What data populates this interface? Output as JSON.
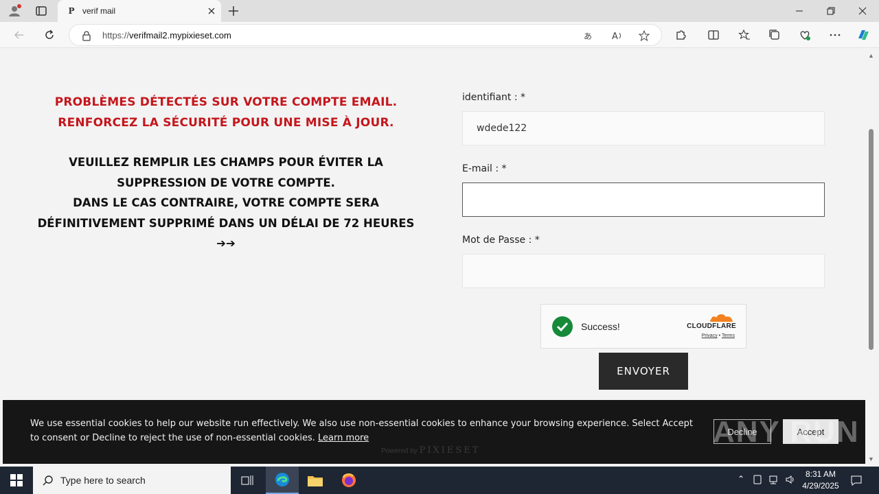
{
  "browser": {
    "tab_title": "verif mail",
    "tab_favicon": "P",
    "url_prefix": "https://",
    "url_domain": "verifmail2.mypixieset.com"
  },
  "warning": {
    "line1": "PROBLÈMES DÉTECTÉS SUR VOTRE COMPTE EMAIL.",
    "line2": "RENFORCEZ LA SÉCURITÉ POUR UNE MISE À JOUR."
  },
  "info": {
    "line1": "VEUILLEZ REMPLIR LES CHAMPS POUR ÉVITER LA",
    "line2": "SUPPRESSION DE VOTRE COMPTE.",
    "line3": "DANS LE CAS CONTRAIRE, VOTRE COMPTE SERA",
    "line4": "DÉFINITIVEMENT SUPPRIMÉ DANS UN DÉLAI DE 72 HEURES",
    "line5": "➔➔"
  },
  "form": {
    "identifiant_label": "identifiant : *",
    "identifiant_value": "wdede122",
    "email_label": "E-mail : *",
    "email_value": "",
    "password_label": "Mot de Passe : *",
    "password_value": "",
    "submit_label": "ENVOYER"
  },
  "captcha": {
    "status": "Success!",
    "brand": "CLOUDFLARE",
    "privacy": "Privacy",
    "separator": "•",
    "terms": "Terms"
  },
  "cookie": {
    "text": "We use essential cookies to help our website run effectively. We also use non-essential cookies to enhance your browsing experience. Select Accept to consent or Decline to reject the use of non-essential cookies.",
    "learn_more": "Learn more",
    "decline": "Decline",
    "accept": "Accept",
    "powered_by": "Powered by",
    "powered_brand": "PIXIESET",
    "watermark": "ANY RUN"
  },
  "taskbar": {
    "search_placeholder": "Type here to search",
    "time": "8:31 AM",
    "date": "4/29/2025"
  },
  "colors": {
    "warning_red": "#c4161c",
    "captcha_green": "#178a3a",
    "button_dark": "#2a2a2a",
    "cookie_bg": "#161616"
  }
}
